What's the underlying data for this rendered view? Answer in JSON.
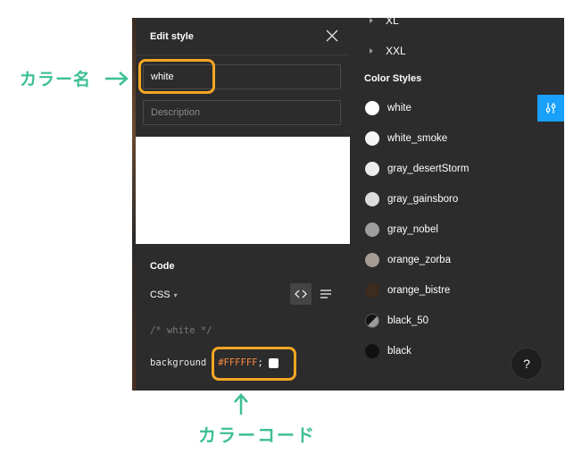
{
  "modal": {
    "title": "Edit style",
    "name_value": "white",
    "description_placeholder": "Description",
    "code_title": "Code",
    "language": "CSS",
    "code_comment": "/* white */",
    "code_property": "background",
    "code_value": "#FFFFFF",
    "code_semicolon": ";"
  },
  "sidebar": {
    "tree_items": [
      "XL",
      "XXL"
    ],
    "section_title": "Color Styles",
    "styles": [
      {
        "name": "white",
        "color": "#FFFFFF"
      },
      {
        "name": "white_smoke",
        "color": "#F5F5F5"
      },
      {
        "name": "gray_desertStorm",
        "color": "#ECECEC"
      },
      {
        "name": "gray_gainsboro",
        "color": "#DCDCDC"
      },
      {
        "name": "gray_nobel",
        "color": "#9E9E9E"
      },
      {
        "name": "orange_zorba",
        "color": "#A59C94"
      },
      {
        "name": "orange_bistre",
        "color": "#3D2B1F"
      },
      {
        "name": "black_50",
        "color": "half"
      },
      {
        "name": "black",
        "color": "#111111"
      }
    ],
    "help_label": "?"
  },
  "annotations": {
    "name_label": "カラー名",
    "code_label": "カラーコード"
  },
  "colors": {
    "panel_bg": "#2c2c2c",
    "accent_blue": "#18a0fb",
    "highlight_orange": "#f5a623",
    "annotation_green": "#3dbf95"
  }
}
